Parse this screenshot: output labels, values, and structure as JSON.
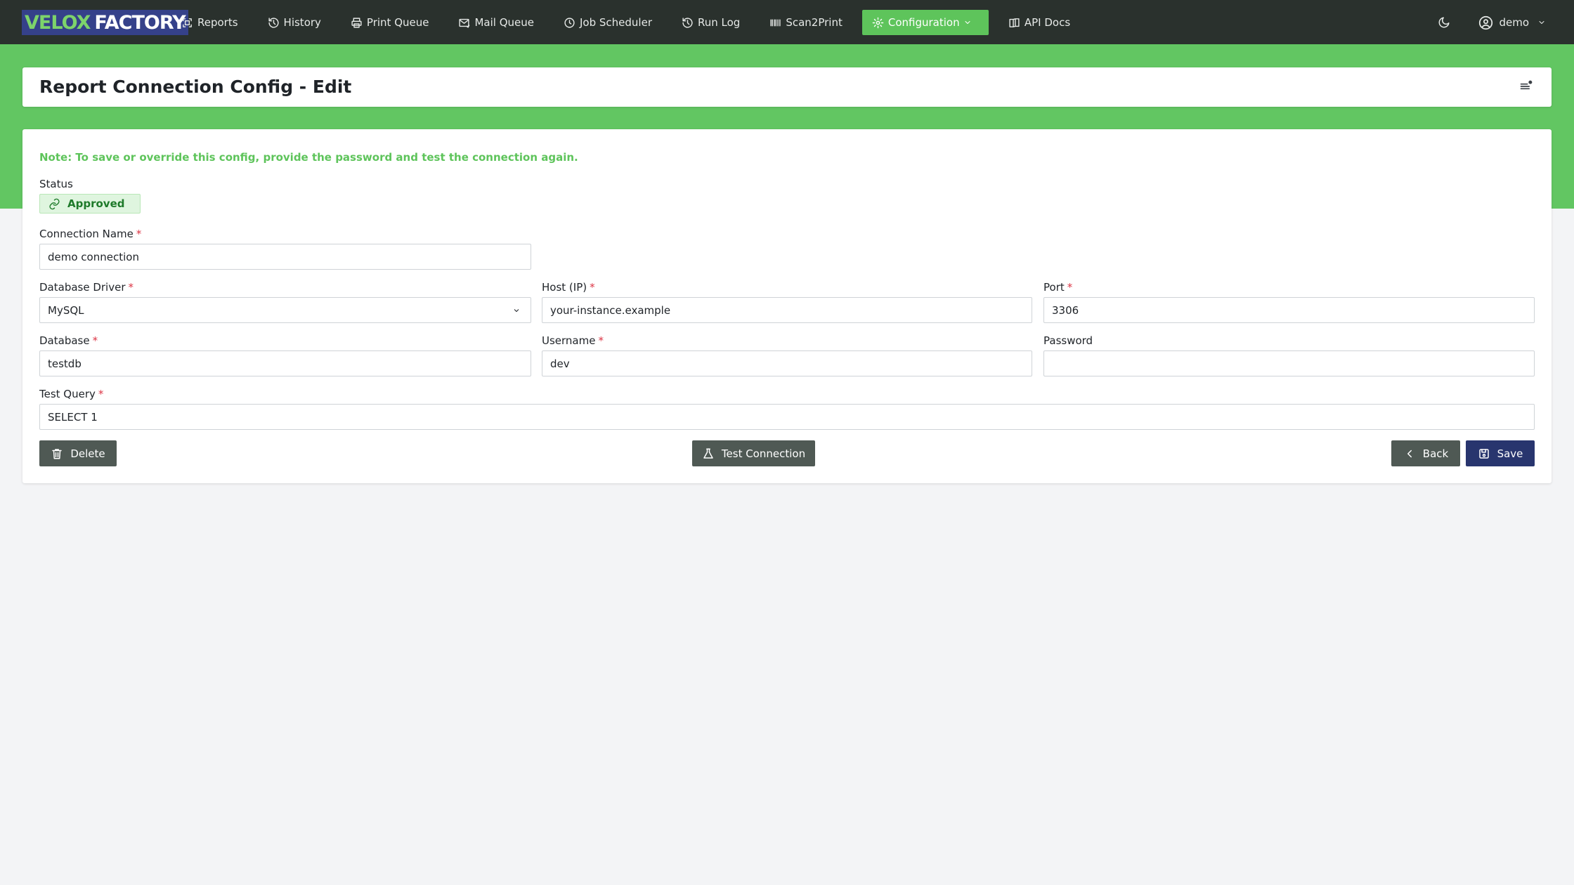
{
  "brand": {
    "part1": "VELOX",
    "part2": "FACTORY"
  },
  "nav": {
    "items": [
      {
        "label": "Reports",
        "icon": "reports-icon"
      },
      {
        "label": "History",
        "icon": "history-icon"
      },
      {
        "label": "Print Queue",
        "icon": "printer-icon"
      },
      {
        "label": "Mail Queue",
        "icon": "mail-icon"
      },
      {
        "label": "Job Scheduler",
        "icon": "clock-icon"
      },
      {
        "label": "Run Log",
        "icon": "history-icon"
      },
      {
        "label": "Scan2Print",
        "icon": "barcode-icon"
      },
      {
        "label": "Configuration",
        "icon": "gear-icon",
        "active": true
      },
      {
        "label": "API Docs",
        "icon": "book-icon"
      }
    ],
    "user": "demo"
  },
  "page": {
    "title": "Report Connection Config - Edit"
  },
  "form": {
    "note": "Note: To save or override this config, provide the password and test the connection again.",
    "status_label": "Status",
    "status_value": "Approved",
    "connection_name": {
      "label": "Connection Name",
      "value": "demo connection"
    },
    "database_driver": {
      "label": "Database Driver",
      "value": "MySQL"
    },
    "host": {
      "label": "Host (IP)",
      "value": "your-instance.example"
    },
    "port": {
      "label": "Port",
      "value": "3306"
    },
    "database": {
      "label": "Database",
      "value": "testdb"
    },
    "username": {
      "label": "Username",
      "value": "dev"
    },
    "password": {
      "label": "Password",
      "value": ""
    },
    "test_query": {
      "label": "Test Query",
      "value": "SELECT 1"
    },
    "required_mark": "*"
  },
  "buttons": {
    "delete": "Delete",
    "test_connection": "Test Connection",
    "back": "Back",
    "save": "Save"
  },
  "colors": {
    "navbar": "#2a312d",
    "accent_green": "#5ec45b",
    "band_green": "#62c662",
    "save_navy": "#28356e",
    "button_dark": "#4f5954",
    "required_red": "#dc3545"
  }
}
